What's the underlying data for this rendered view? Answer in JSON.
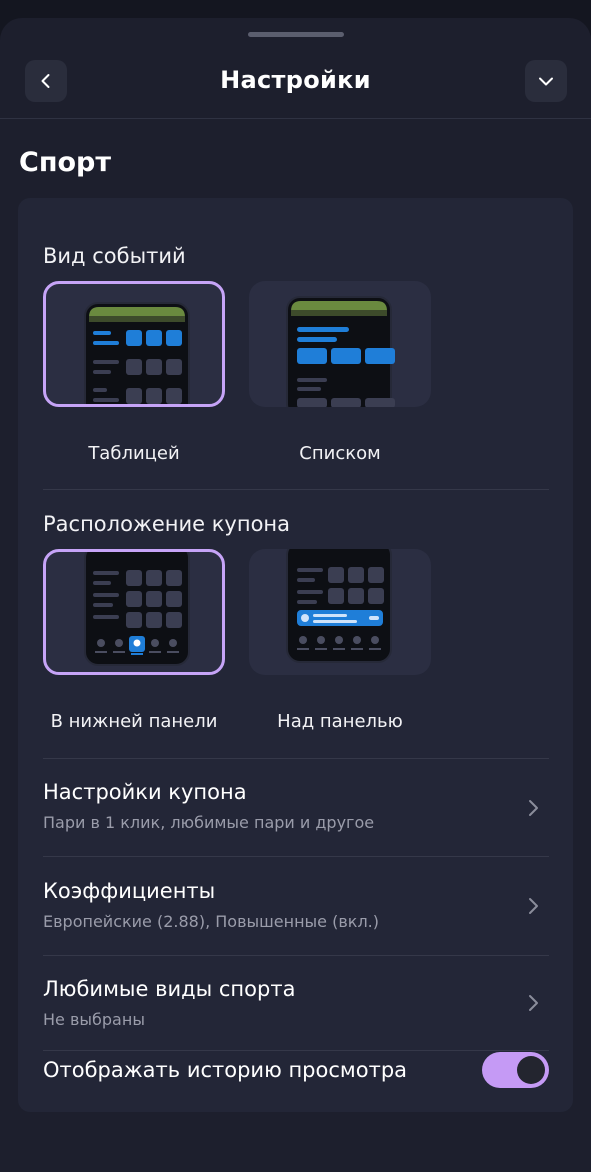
{
  "header": {
    "title": "Настройки"
  },
  "section": {
    "title": "Спорт"
  },
  "events_view": {
    "title": "Вид событий",
    "options": [
      {
        "label": "Таблицей",
        "selected": true
      },
      {
        "label": "Списком",
        "selected": false
      }
    ]
  },
  "coupon_position": {
    "title": "Расположение купона",
    "options": [
      {
        "label": "В нижней панели",
        "selected": true
      },
      {
        "label": "Над панелью",
        "selected": false
      }
    ]
  },
  "rows": [
    {
      "title": "Настройки купона",
      "subtitle": "Пари в 1 клик, любимые пари и другое"
    },
    {
      "title": "Коэффициенты",
      "subtitle": "Европейские (2.88), Повышенные (вкл.)"
    },
    {
      "title": "Любимые виды спорта",
      "subtitle": "Не выбраны"
    }
  ],
  "history_toggle": {
    "label": "Отображать историю просмотра",
    "on": true
  },
  "colors": {
    "accent": "#c59af5",
    "blue": "#1f7ed8",
    "green": "#6a8a3f"
  }
}
